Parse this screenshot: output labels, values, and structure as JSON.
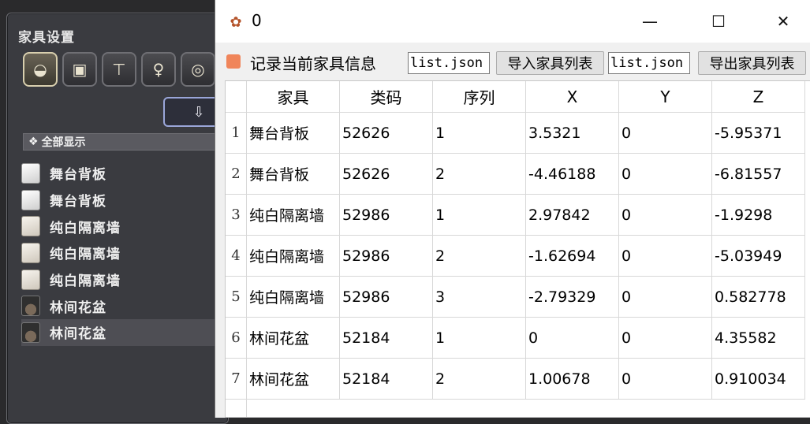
{
  "game": {
    "title": "家具设置",
    "categories": [
      {
        "icon": "sack-icon",
        "glyph": "◒"
      },
      {
        "icon": "cabinet-icon",
        "glyph": "▣"
      },
      {
        "icon": "table-icon",
        "glyph": "⊤"
      },
      {
        "icon": "figure-icon",
        "glyph": "♀"
      },
      {
        "icon": "ring-icon",
        "glyph": "◎"
      }
    ],
    "sort_glyph": "⇩",
    "filter_label": "全部显示",
    "items": [
      {
        "label": "舞台背板",
        "icon": "board"
      },
      {
        "label": "舞台背板",
        "icon": "board"
      },
      {
        "label": "纯白隔离墙",
        "icon": "wall"
      },
      {
        "label": "纯白隔离墙",
        "icon": "wall"
      },
      {
        "label": "纯白隔离墙",
        "icon": "wall"
      },
      {
        "label": "林间花盆",
        "icon": "pot"
      },
      {
        "label": "林间花盆",
        "icon": "pot"
      }
    ]
  },
  "window": {
    "title": "0",
    "controls": {
      "minimize": "—",
      "maximize": "☐",
      "close": "✕"
    }
  },
  "toolbar": {
    "record_label": "记录当前家具信息",
    "import_file": "list.json",
    "import_button": "导入家具列表",
    "export_file": "list.json",
    "export_button": "导出家具列表"
  },
  "table": {
    "headers": [
      "家具",
      "类码",
      "序列",
      "X",
      "Y",
      "Z"
    ],
    "rows": [
      {
        "num": "1",
        "cells": [
          "舞台背板",
          "52626",
          "1",
          "3.5321",
          "0",
          "-5.95371"
        ]
      },
      {
        "num": "2",
        "cells": [
          "舞台背板",
          "52626",
          "2",
          "-4.46188",
          "0",
          "-6.81557"
        ]
      },
      {
        "num": "3",
        "cells": [
          "纯白隔离墙",
          "52986",
          "1",
          "2.97842",
          "0",
          "-1.9298"
        ]
      },
      {
        "num": "4",
        "cells": [
          "纯白隔离墙",
          "52986",
          "2",
          "-1.62694",
          "0",
          "-5.03949"
        ]
      },
      {
        "num": "5",
        "cells": [
          "纯白隔离墙",
          "52986",
          "3",
          "-2.79329",
          "0",
          "0.582778"
        ]
      },
      {
        "num": "6",
        "cells": [
          "林间花盆",
          "52184",
          "1",
          "0",
          "0",
          "4.35582"
        ]
      },
      {
        "num": "7",
        "cells": [
          "林间花盆",
          "52184",
          "2",
          "1.00678",
          "0",
          "0.910034"
        ]
      }
    ]
  }
}
